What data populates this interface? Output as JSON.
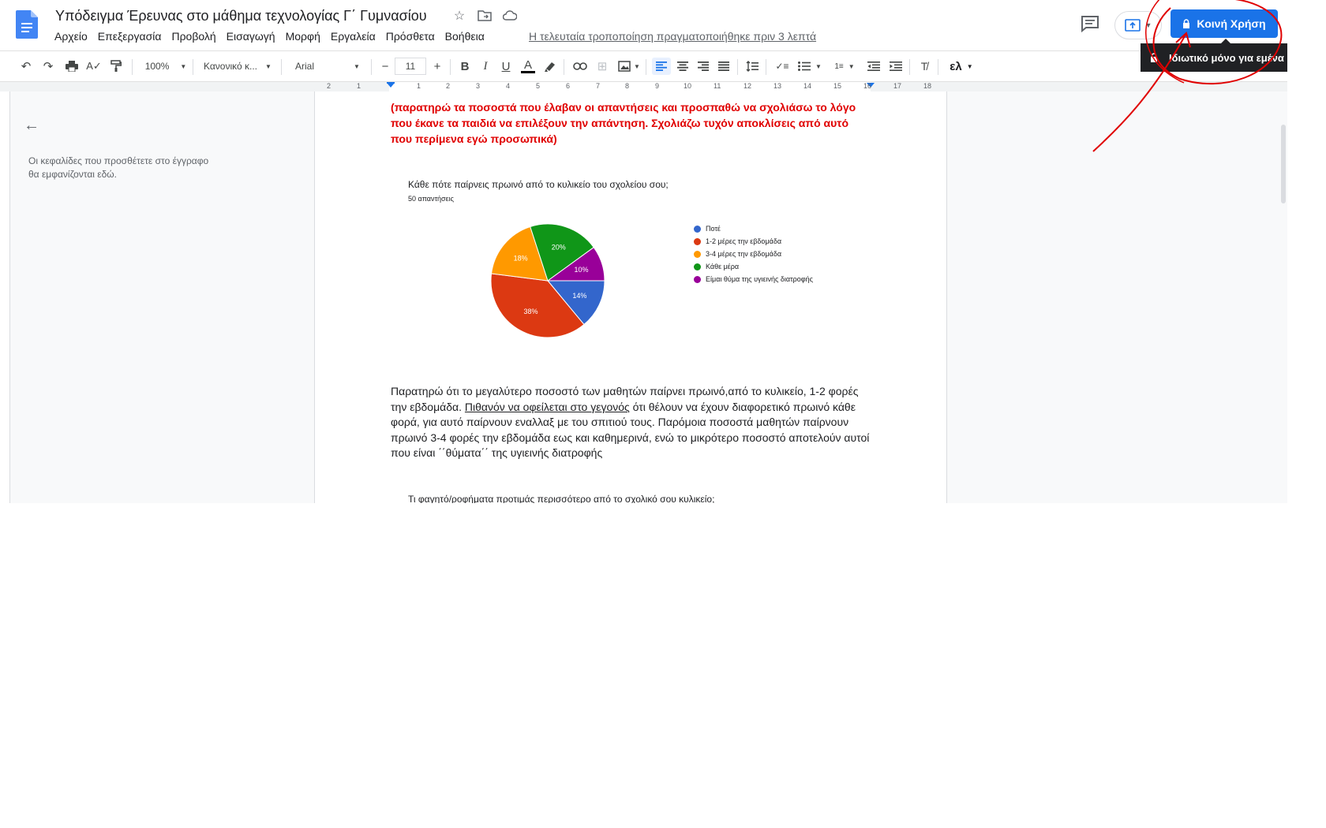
{
  "header": {
    "title": "Υπόδειγμα Έρευνας στο μάθημα τεχνολογίας Γ΄ Γυμνασίου",
    "menu": [
      "Αρχείο",
      "Επεξεργασία",
      "Προβολή",
      "Εισαγωγή",
      "Μορφή",
      "Εργαλεία",
      "Πρόσθετα",
      "Βοήθεια"
    ],
    "last_edit": "Η τελευταία τροποποίηση πραγματοποιήθηκε πριν 3 λεπτά",
    "share_label": "Κοινή Χρήση",
    "tooltip": "Ιδιωτικό μόνο για εμένα"
  },
  "toolbar": {
    "zoom": "100%",
    "style": "Κανονικό κ...",
    "font": "Arial",
    "font_size": "11",
    "input_tool": "ελ"
  },
  "ruler": [
    "2",
    "1",
    "1",
    "2",
    "3",
    "4",
    "5",
    "6",
    "7",
    "8",
    "9",
    "10",
    "11",
    "12",
    "13",
    "14",
    "15",
    "16",
    "17",
    "18"
  ],
  "outline": {
    "text": "Οι κεφαλίδες που προσθέτετε στο έγγραφο θα εμφανίζονται εδώ."
  },
  "document": {
    "red_paragraph": "(παρατηρώ τα ποσοστά που έλαβαν οι απαντήσεις και προσπαθώ να σχολιάσω το λόγο που έκανε τα παιδιά να επιλέξουν την απάντηση. Σχολιάζω τυχόν αποκλίσεις από αυτό που περίμενα εγώ προσωπικά)",
    "body_part1": "Παρατηρώ ότι το μεγαλύτερο ποσοστό των μαθητών παίρνει πρωινό,από το κυλικείο, 1-2 φορές την εβδομάδα. ",
    "body_underlined": "Πιθανόν να οφείλεται στο γεγονός",
    "body_part2": " ότι θέλουν να έχουν διαφορετικό πρωινό κάθε φορά, για αυτό παίρνουν εναλλαξ με του σπιτιού τους. Παρόμοια ποσοστά μαθητών παίρνουν πρωινό 3-4 φορές την εβδομάδα εως και καθημερινά, ενώ το μικρότερο ποσοστό αποτελούν αυτοί που είναι ΄΄θύματα΄΄ της υγιεινής διατροφής",
    "next_chart_title": "Τι φαγητό/ροφήματα προτιμάς περισσότερο από το σχολικό σου κυλικείο;"
  },
  "chart_data": {
    "type": "pie",
    "title": "Κάθε πότε παίρνεις πρωινό από το κυλικείο του σχολείου σου;",
    "subtitle": "50 απαντήσεις",
    "slices": [
      {
        "label": "Ποτέ",
        "value": 14,
        "display": "14%",
        "color": "#3366cc"
      },
      {
        "label": "1-2 μέρες την εβδομάδα",
        "value": 38,
        "display": "38%",
        "color": "#dc3912"
      },
      {
        "label": "3-4 μέρες την εβδομάδα",
        "value": 18,
        "display": "18%",
        "color": "#ff9900"
      },
      {
        "label": "Κάθε μέρα",
        "value": 20,
        "display": "20%",
        "color": "#109618"
      },
      {
        "label": "Είμαι θύμα της υγιεινής διατροφής",
        "value": 10,
        "display": "10%",
        "color": "#990099"
      }
    ],
    "legend": "right"
  }
}
